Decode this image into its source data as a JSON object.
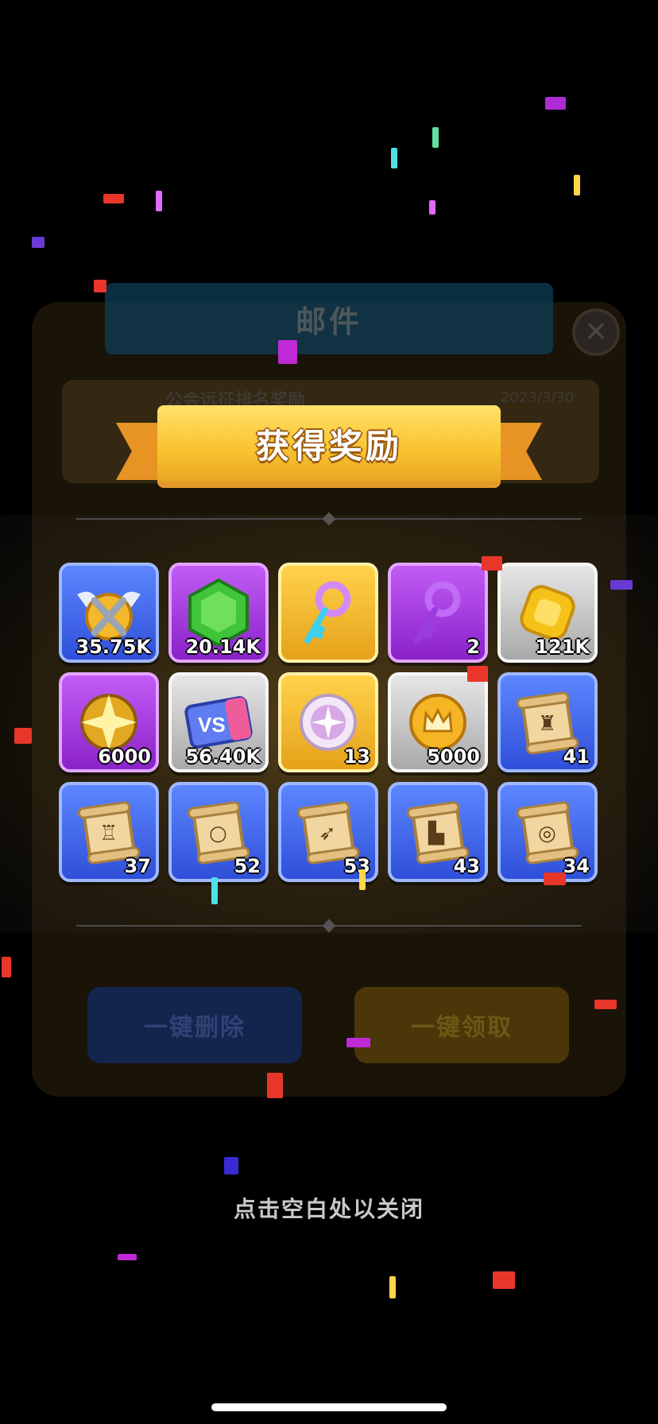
{
  "mail_panel": {
    "title": "邮件",
    "close_glyph": "✕",
    "mail_title": "公会远征排名奖励",
    "mail_date": "2023/3/30",
    "delete_all_label": "一键删除",
    "claim_all_label": "一键领取"
  },
  "reward_popup": {
    "banner_title": "获得奖励",
    "close_hint": "点击空白处以关闭",
    "rewards": [
      {
        "icon": "winged-shield-icon",
        "rarity": "blue",
        "count": "35.75K"
      },
      {
        "icon": "green-gem-icon",
        "rarity": "purple",
        "count": "20.14K"
      },
      {
        "icon": "cyan-key-icon",
        "rarity": "gold",
        "count": ""
      },
      {
        "icon": "purple-key-icon",
        "rarity": "purple",
        "count": "2"
      },
      {
        "icon": "gold-coin-icon",
        "rarity": "grey",
        "count": "121K"
      },
      {
        "icon": "gold-star-emblem-icon",
        "rarity": "purple",
        "count": "6000"
      },
      {
        "icon": "vs-ticket-icon",
        "rarity": "grey",
        "count": "56.40K"
      },
      {
        "icon": "pink-orb-icon",
        "rarity": "gold",
        "count": "13"
      },
      {
        "icon": "crown-coin-icon",
        "rarity": "grey",
        "count": "5000"
      },
      {
        "icon": "scroll-helmet-icon",
        "rarity": "blue",
        "count": "41"
      },
      {
        "icon": "scroll-armor-icon",
        "rarity": "blue",
        "count": "37"
      },
      {
        "icon": "scroll-necklace-icon",
        "rarity": "blue",
        "count": "52"
      },
      {
        "icon": "scroll-bow-icon",
        "rarity": "blue",
        "count": "53"
      },
      {
        "icon": "scroll-boot-icon",
        "rarity": "blue",
        "count": "43"
      },
      {
        "icon": "scroll-ring-icon",
        "rarity": "blue",
        "count": "34"
      }
    ]
  },
  "colors": {
    "blue_tile": "#3f62e6",
    "purple_tile": "#a63be0",
    "gold_tile": "#f2b830",
    "grey_tile": "#c4c4c4",
    "banner": "#f8c32e"
  }
}
